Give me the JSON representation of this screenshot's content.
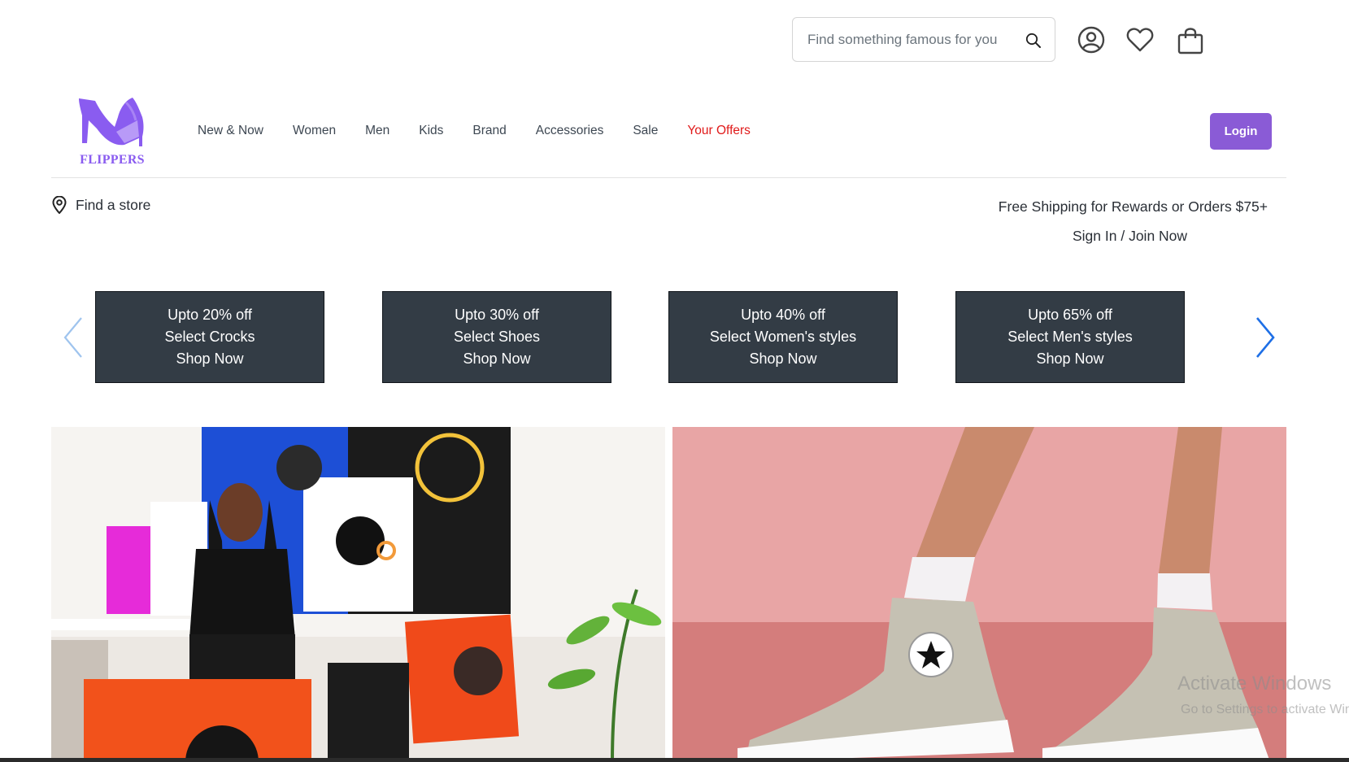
{
  "search": {
    "placeholder": "Find something famous for you"
  },
  "header_icons": [
    "user-icon",
    "heart-icon",
    "shopping-bag-icon"
  ],
  "brand": {
    "name": "FLIPPERS",
    "color": "#8a5cf0"
  },
  "nav": {
    "items": [
      "New & Now",
      "Women",
      "Men",
      "Kids",
      "Brand",
      "Accessories",
      "Sale",
      "Your Offers"
    ],
    "offers_color": "#e01a1a"
  },
  "login": {
    "label": "Login",
    "color": "#8a5bd6"
  },
  "store_bar": {
    "find_store": "Find a store",
    "shipping": "Free Shipping for Rewards or Orders $75+",
    "signin": "Sign In / Join Now"
  },
  "promos": [
    {
      "line1": "Upto 20% off",
      "line2": "Select Crocks",
      "line3": "Shop Now"
    },
    {
      "line1": "Upto 30% off",
      "line2": "Select Shoes",
      "line3": "Shop Now"
    },
    {
      "line1": "Upto 40% off",
      "line2": "Select Women's styles",
      "line3": "Shop Now"
    },
    {
      "line1": "Upto 65% off",
      "line2": "Select Men's styles",
      "line3": "Shop Now"
    }
  ],
  "carousel": {
    "prev_icon": "chevron-left-icon",
    "next_icon": "chevron-right-icon"
  },
  "hero": {
    "left": "woman-with-artwork-photo",
    "right": "converse-sneakers-photo"
  },
  "overlay": {
    "line1": "Activate Windows",
    "line2": "Go to Settings to activate Windows."
  }
}
